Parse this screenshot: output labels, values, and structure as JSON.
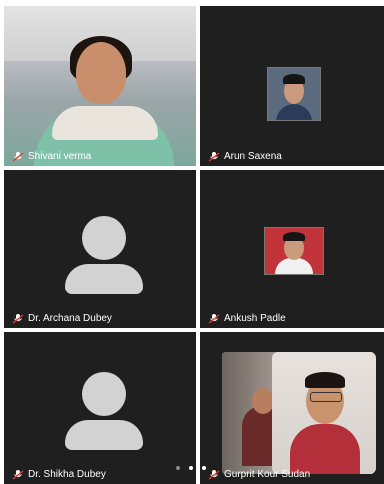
{
  "participants": [
    {
      "name": "Shivani verma",
      "video": "camera-on"
    },
    {
      "name": "Arun Saxena",
      "video": "photo"
    },
    {
      "name": "Dr. Archana Dubey",
      "video": "avatar-silhouette"
    },
    {
      "name": "Ankush Padle",
      "video": "photo"
    },
    {
      "name": "Dr. Shikha Dubey",
      "video": "avatar-silhouette"
    },
    {
      "name": "Gurprit Kour Sudan",
      "video": "camera-on"
    }
  ],
  "mic_state": "muted",
  "page_indicator": {
    "pages": 3,
    "active": 2
  },
  "colors": {
    "tile_bg": "#1f1f1f",
    "label": "#ffffff",
    "avatar": "#d2d2d2"
  },
  "icons": {
    "mic": "mic-off-icon"
  }
}
